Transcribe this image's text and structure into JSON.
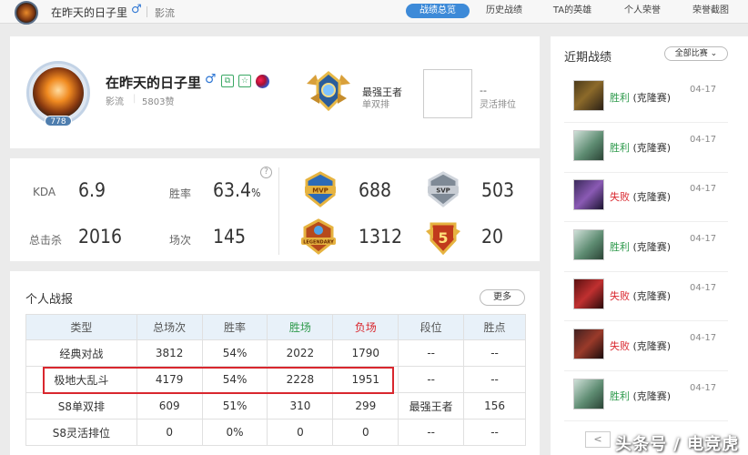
{
  "topbar": {
    "name": "在昨天的日子里",
    "gender_symbol": "♂",
    "server": "影流",
    "tabs": [
      "战绩总览",
      "历史战绩",
      "TA的英雄",
      "个人荣誉",
      "荣誉截图"
    ],
    "active_tab": 0,
    "accent_color": "#3d8ad8"
  },
  "profile": {
    "name": "在昨天的日子里",
    "gender_symbol": "♂",
    "level": "778",
    "server": "影流",
    "likes": "5803赞",
    "solo_rank": {
      "tier": "最强王者",
      "queue": "单双排"
    },
    "flex_rank": {
      "tier": "--",
      "queue": "灵活排位"
    }
  },
  "stats": {
    "kda_label": "KDA",
    "kda": "6.9",
    "winrate_label": "胜率",
    "winrate": "63.4",
    "winrate_unit": "%",
    "kills_label": "总击杀",
    "kills": "2016",
    "games_label": "场次",
    "games": "145",
    "help_icon": "?",
    "honors": [
      {
        "icon": "mvp-badge-icon",
        "value": "688"
      },
      {
        "icon": "svp-badge-icon",
        "value": "503"
      },
      {
        "icon": "legendary-badge-icon",
        "value": "1312"
      },
      {
        "icon": "pentakill-badge-icon",
        "value": "20"
      }
    ]
  },
  "record": {
    "title": "个人战报",
    "more_label": "更多",
    "headers": [
      "类型",
      "总场次",
      "胜率",
      "胜场",
      "负场",
      "段位",
      "胜点"
    ],
    "header_colors": {
      "win": "#2e9a4c",
      "loss": "#d9272e"
    },
    "rows": [
      [
        "经典对战",
        "3812",
        "54%",
        "2022",
        "1790",
        "--",
        "--"
      ],
      [
        "极地大乱斗",
        "4179",
        "54%",
        "2228",
        "1951",
        "--",
        "--"
      ],
      [
        "S8单双排",
        "609",
        "51%",
        "310",
        "299",
        "最强王者",
        "156"
      ],
      [
        "S8灵活排位",
        "0",
        "0%",
        "0",
        "0",
        "--",
        "--"
      ]
    ],
    "highlight_row": 1
  },
  "recent": {
    "title": "近期战绩",
    "filter_label": "全部比赛",
    "matches": [
      {
        "result": "胜利",
        "mode": "(克隆赛)",
        "date": "04-17",
        "win": true
      },
      {
        "result": "胜利",
        "mode": "(克隆赛)",
        "date": "04-17",
        "win": true
      },
      {
        "result": "失败",
        "mode": "(克隆赛)",
        "date": "04-17",
        "win": false
      },
      {
        "result": "胜利",
        "mode": "(克隆赛)",
        "date": "04-17",
        "win": true
      },
      {
        "result": "失败",
        "mode": "(克隆赛)",
        "date": "04-17",
        "win": false
      },
      {
        "result": "失败",
        "mode": "(克隆赛)",
        "date": "04-17",
        "win": false
      },
      {
        "result": "胜利",
        "mode": "(克隆赛)",
        "date": "04-17",
        "win": true
      }
    ],
    "win_color": "#2e9a4c",
    "loss_color": "#d9272e",
    "pager_prev": "<"
  },
  "watermark": "头条号 / 电竞虎"
}
